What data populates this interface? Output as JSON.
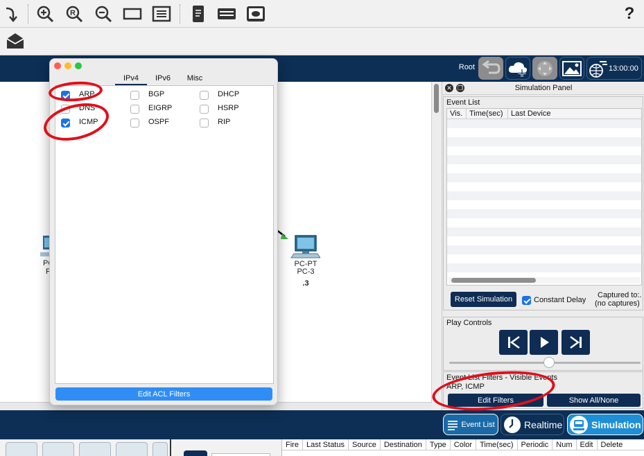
{
  "toolbar": {
    "icons": [
      "redo-icon",
      "zoom-in-icon",
      "zoom-reset-icon",
      "zoom-out-icon",
      "rectangle-icon",
      "palette-icon",
      "note-icon",
      "device-icon",
      "custom-device-icon",
      "help-icon"
    ],
    "help_label": "?"
  },
  "header": {
    "root_label": "Root",
    "time_label": "13:00:00"
  },
  "workspace": {
    "devices": [
      {
        "type": "PC-PT",
        "name": "PC-3",
        "ip": ".3"
      }
    ],
    "partial_device_label_1": "PC",
    "partial_device_label_2": "P"
  },
  "dialog": {
    "tabs": [
      {
        "label": "IPv4",
        "active": true
      },
      {
        "label": "IPv6",
        "active": false
      },
      {
        "label": "Misc",
        "active": false
      }
    ],
    "protocols": [
      {
        "label": "ARP",
        "checked": true
      },
      {
        "label": "BGP",
        "checked": false
      },
      {
        "label": "DHCP",
        "checked": false
      },
      {
        "label": "DNS",
        "checked": false
      },
      {
        "label": "EIGRP",
        "checked": false
      },
      {
        "label": "HSRP",
        "checked": false
      },
      {
        "label": "ICMP",
        "checked": true
      },
      {
        "label": "OSPF",
        "checked": false
      },
      {
        "label": "RIP",
        "checked": false
      }
    ],
    "edit_acl_label": "Edit ACL Filters"
  },
  "sim_panel": {
    "title": "Simulation Panel",
    "event_list_label": "Event List",
    "columns": [
      "Vis.",
      "Time(sec)",
      "Last Device"
    ],
    "reset_label": "Reset Simulation",
    "constant_delay_label": "Constant Delay",
    "constant_delay_checked": true,
    "captured_label": "Captured to:.",
    "captured_value": "(no captures)",
    "play_controls_label": "Play Controls",
    "play_speed": 0.52,
    "filters_label": "Event List Filters - Visible Events",
    "filters_value": "ARP, ICMP",
    "edit_filters_label": "Edit Filters",
    "show_all_label": "Show All/None"
  },
  "modes": {
    "event_list_label": "Event List",
    "realtime_label": "Realtime",
    "simulation_label": "Simulation"
  },
  "pdu_table": {
    "columns": [
      "Fire",
      "Last Status",
      "Source",
      "Destination",
      "Type",
      "Color",
      "Time(sec)",
      "Periodic",
      "Num",
      "Edit",
      "Delete"
    ]
  },
  "colors": {
    "navy": "#0d2f55",
    "accent_blue": "#2f8ef6",
    "highlight_red": "#e0101a",
    "sim_active": "#1e8fd6"
  }
}
